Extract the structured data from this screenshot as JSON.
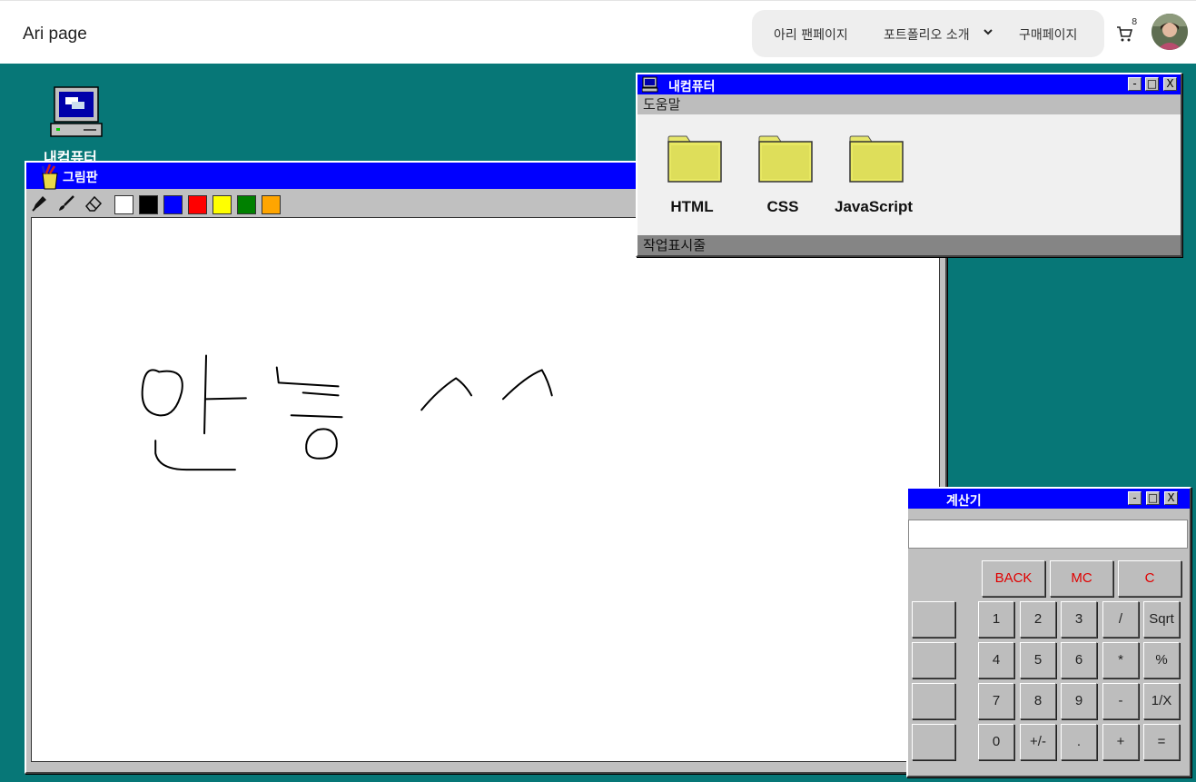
{
  "header": {
    "brand": "Ari page",
    "nav": {
      "fan_page": "아리 팬페이지",
      "portfolio": "포트폴리오 소개",
      "purchase": "구매페이지"
    },
    "cart_count": "8",
    "cart_icon": "cart-icon",
    "avatar_icon": "user-avatar"
  },
  "desktop": {
    "background": "#077777",
    "icons": [
      {
        "label": "내컴퓨터",
        "icon": "computer-icon"
      }
    ]
  },
  "paint": {
    "title": "그림판",
    "tools": [
      "pen-icon",
      "brush-icon",
      "eraser-icon"
    ],
    "colors": [
      "#ffffff",
      "#000000",
      "#0000ff",
      "#ff0000",
      "#ffff00",
      "#008000",
      "#ffa500"
    ]
  },
  "my_computer": {
    "title": "내컴퓨터",
    "menu": "도움말",
    "folders": [
      "HTML",
      "CSS",
      "JavaScript"
    ],
    "status": "작업표시줄",
    "window_buttons": [
      "-",
      "□",
      "X"
    ]
  },
  "calculator": {
    "title": "계산기",
    "display": "",
    "top_buttons": [
      "BACK",
      "MC",
      "C"
    ],
    "rows": [
      [
        "1",
        "2",
        "3",
        "/",
        "Sqrt"
      ],
      [
        "4",
        "5",
        "6",
        "*",
        "%"
      ],
      [
        "7",
        "8",
        "9",
        "-",
        "1/X"
      ],
      [
        "0",
        "+/-",
        ".",
        "+",
        "="
      ]
    ]
  },
  "colors": {
    "titlebar": "#0000ff",
    "window": "#c0c0c0",
    "accent_red": "#e00000"
  }
}
